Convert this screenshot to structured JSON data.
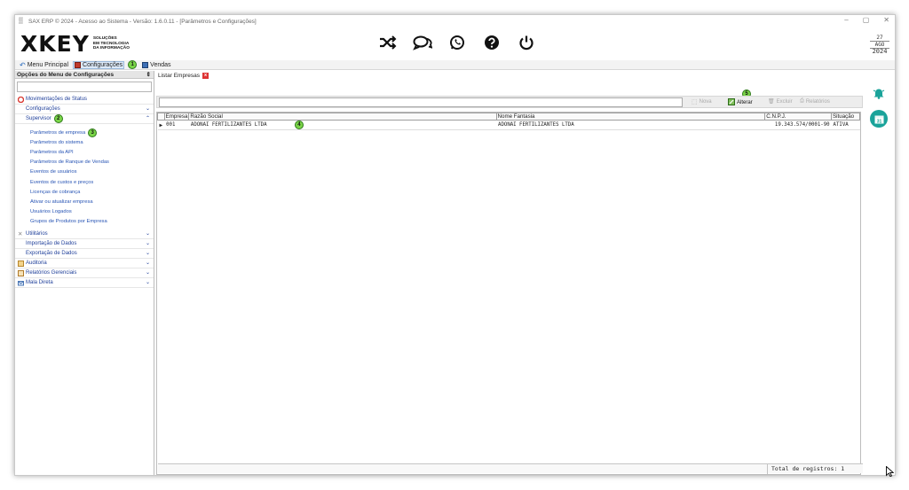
{
  "window": {
    "title": "SAX ERP © 2024 - Acesso ao Sistema - Versão: 1.6.0.11 - [Parâmetros e Configurações]",
    "controls": [
      "–",
      "▢",
      "✕"
    ]
  },
  "header": {
    "logo_text": "XKEY",
    "logo_tagline_1": "SOLUÇÕES",
    "logo_tagline_2": "EM TECNOLOGIA",
    "logo_tagline_3": "DA INFORMAÇÃO",
    "icons": [
      "shuffle-icon",
      "chat-icon",
      "whatsapp-icon",
      "help-icon",
      "power-icon"
    ],
    "date": {
      "day": "27",
      "month": "AGO",
      "year": "2024"
    }
  },
  "menu": {
    "items": [
      {
        "label": "Menu Principal",
        "icon": "back-arrow-icon"
      },
      {
        "label": "Configurações",
        "icon": "config-icon",
        "badge": "1"
      },
      {
        "label": "Vendas",
        "icon": "sales-icon"
      }
    ]
  },
  "sidebar": {
    "title": "Opções do Menu de Configurações",
    "pin": "⇕",
    "items": [
      {
        "label": "Movimentações de Status",
        "icon": "status-icon"
      },
      {
        "label": "Configurações",
        "chevron": "down"
      },
      {
        "label": "Supervisor",
        "chevron": "up",
        "badge": "2"
      }
    ],
    "subitems": [
      {
        "label": "Parâmetros de empresa",
        "badge": "3"
      },
      {
        "label": "Parâmetros do sistema"
      },
      {
        "label": "Parâmetros da API"
      },
      {
        "label": "Parâmetros de Ranque de Vendas"
      },
      {
        "label": "Eventos de usuários"
      },
      {
        "label": "Eventos de custos e preços"
      },
      {
        "label": "Licenças de cobrança"
      },
      {
        "label": "Ativar ou atualizar empresa"
      },
      {
        "label": "Usuários Logados"
      },
      {
        "label": "Grupos de Produtos por Empresa"
      }
    ],
    "items_after": [
      {
        "label": "Utilitários",
        "icon": "tools-icon"
      },
      {
        "label": "Importação de Dados"
      },
      {
        "label": "Exportação de Dados"
      },
      {
        "label": "Auditoria",
        "icon": "audit-icon"
      },
      {
        "label": "Relatórios Gerenciais",
        "icon": "report-icon"
      },
      {
        "label": "Mala Direta",
        "icon": "mail-icon"
      }
    ]
  },
  "tab": {
    "label": "Listar Empresas",
    "close": "x"
  },
  "toolbar": {
    "nova": "Nova",
    "alterar": "Alterar",
    "alterar_badge": "5",
    "excluir": "Excluir",
    "relatorios": "Relatórios"
  },
  "grid": {
    "columns": [
      "Empresa",
      "Razão Social",
      "Nome Fantasia",
      "C.N.P.J.",
      "Situação"
    ],
    "rows": [
      {
        "empresa": "001",
        "razao_social": "ADONAI FERTILIZANTES LTDA",
        "razao_badge": "4",
        "nome_fantasia": "ADONAI FERTILIZANTES LTDA",
        "cnpj": "19.343.574/0001-90",
        "situacao": "ATIVA"
      }
    ]
  },
  "status": {
    "total": "Total de registros: 1"
  },
  "colors": {
    "accent_green": "#7ad548",
    "teal": "#1aa39a",
    "link_blue": "#2855b5",
    "close_red": "#d33333"
  }
}
